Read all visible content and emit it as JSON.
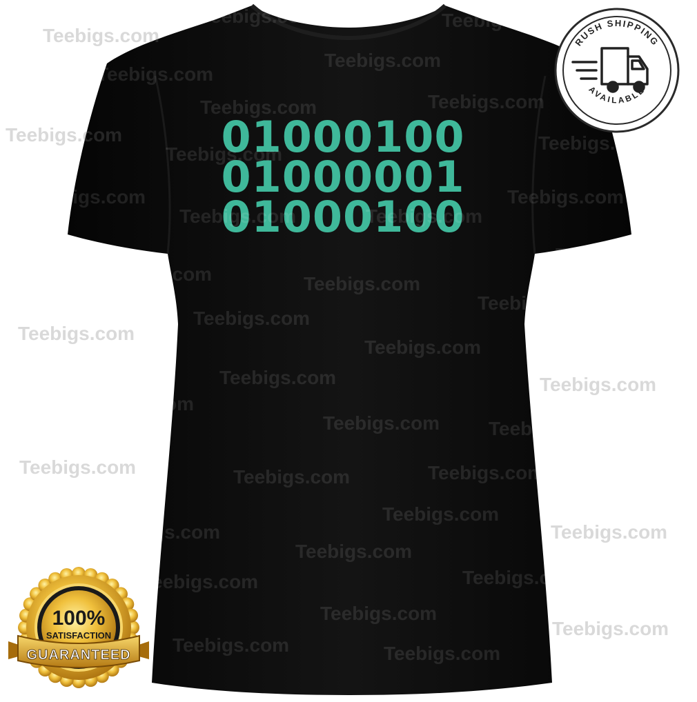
{
  "product": {
    "shirt_color": "#0b0b0b",
    "print_color": "#3fb89a",
    "binary_lines": [
      "01000100",
      "01000001",
      "01000100"
    ]
  },
  "badges": {
    "shipping": {
      "top_text": "RUSH SHIPPING",
      "bottom_text": "AVAILABLE",
      "icon": "truck-icon"
    },
    "guarantee": {
      "line1": "100%",
      "line2": "SATISFACTION",
      "ribbon": "GUARANTEED",
      "icon": "gold-seal-icon"
    }
  },
  "watermark": {
    "text": "Teebigs.com"
  }
}
